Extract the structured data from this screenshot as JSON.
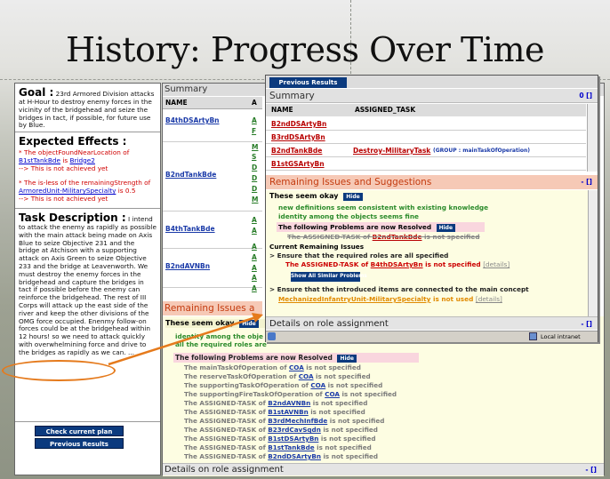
{
  "slide": {
    "title": "History: Progress Over Time"
  },
  "left_panel": {
    "goal_label": "Goal :",
    "goal_text": "23rd Armored Division attacks at H-Hour to destroy enemy forces in the vicinity of the bridgehead and seize the bridges in tact, if possible, for future use by Blue.",
    "effects_label": "Expected Effects :",
    "effect1_prefix": "* The objectFoundNearLocation of",
    "effect1_link1": "B1stTankBde",
    "effect1_is": "is",
    "effect1_link2": "Bridge2",
    "effect1_status": "--> This is not achieved yet",
    "effect2_prefix": "* The is-less of the remainingStrength of",
    "effect2_link": "ArmoredUnit-MilitarySpecialty",
    "effect2_suffix": "is 0.5",
    "effect2_status": "--> This is not achieved yet",
    "task_label": "Task Description :",
    "task_text": "I intend to attack the enemy as rapidly as possible with the main attack being made on Axis Blue to seize Objective 231 and the bridge at Atchison with a supporting attack on Axis Green to seize Objective 233 and the bridge at Leavenworth. We must destroy the enemy forces in the bridgehead and capture the bridges in tact if possible before the enemy can reinforce the bridgehead. The rest of III Corps will attack up the east side of the river and keep the other divisions of the OMG force occupied. Enenmy follow-on forces could be at the bridgehead within 12 hours! so we need to attack quickly with overwhelmining force and drive to the bridges as rapidly as we can. ...",
    "check_btn": "Check current plan",
    "prev_btn": "Previous Results"
  },
  "main_panel": {
    "summary": "Summary",
    "col_name": "NAME",
    "col_a": "A",
    "rows": [
      "B4thDSArtyBn",
      "B2ndTankBde",
      "B4thTankBde",
      "B2ndAVNBn"
    ],
    "a_col_letters": [
      "A",
      "F",
      "M",
      "S",
      "D",
      "D",
      "D",
      "M",
      "A",
      "A",
      "A",
      "A",
      "A",
      "A",
      "A"
    ],
    "remaining": "Remaining Issues a",
    "okay": "These seem okay",
    "okay_hide": "Hide",
    "okay_line1": "identity among the obje",
    "okay_line2": "all the required roles are",
    "resolved_label": "The following Problems are now Resolved",
    "resolved_hide": "Hide",
    "resolved_items": [
      {
        "pre": "The mainTaskOfOperation of ",
        "link": "COA",
        "post": " is not specified"
      },
      {
        "pre": "The reserveTaskOfOperation of ",
        "link": "COA",
        "post": " is not specified"
      },
      {
        "pre": "The supportingTaskOfOperation of ",
        "link": "COA",
        "post": " is not specified"
      },
      {
        "pre": "The supportingFireTaskOfOperation of ",
        "link": "COA",
        "post": " is not specified"
      },
      {
        "pre": "The ASSIGNED-TASK of ",
        "link": "B2ndAVNBn",
        "post": " is not specified"
      },
      {
        "pre": "The ASSIGNED-TASK of ",
        "link": "B1stAVNBn",
        "post": " is not specified"
      },
      {
        "pre": "The ASSIGNED-TASK of ",
        "link": "B3rdMechInfBde",
        "post": " is not specified"
      },
      {
        "pre": "The ASSIGNED-TASK of ",
        "link": "B23rdCavSqdn",
        "post": " is not specified"
      },
      {
        "pre": "The ASSIGNED-TASK of ",
        "link": "B1stDSArtyBn",
        "post": " is not specified"
      },
      {
        "pre": "The ASSIGNED-TASK of ",
        "link": "B1stTankBde",
        "post": " is not specified"
      },
      {
        "pre": "The ASSIGNED-TASK of ",
        "link": "B2ndDSArtyBn",
        "post": " is not specified"
      }
    ],
    "details": "Details on role assignment",
    "details_ctl": "- []"
  },
  "overlay": {
    "tab": "Previous Results",
    "summary": "Summary",
    "summary_ctl": "0 []",
    "col_name": "NAME",
    "col_task": "ASSIGNED_TASK",
    "rows": [
      {
        "name": "B2ndDSArtyBn",
        "task": "",
        "group": ""
      },
      {
        "name": "B3rdDSArtyBn",
        "task": "",
        "group": ""
      },
      {
        "name": "B2ndTankBde",
        "task": "Destroy-MilitaryTask",
        "group": "(GROUP : mainTaskOfOperation)"
      },
      {
        "name": "B1stGSArtyBn",
        "task": "",
        "group": ""
      }
    ],
    "remaining": "Remaining Issues and Suggestions",
    "remaining_ctl": "- []",
    "okay": "These seem okay",
    "okay_hide": "Hide",
    "okay_line1": "new definitions seem consistent with existing knowledge",
    "okay_line2": "identity among the objects seems fine",
    "now_resolved": "The following Problems are now Resolved",
    "now_resolved_hide": "Hide",
    "struck_pre": "The ASSIGNED-TASK of ",
    "struck_link": "B2ndTankBde",
    "struck_post": " is not specified",
    "current": "Current Remaining Issues",
    "issue1": "> Ensure that the required roles are all specified",
    "issue1_pre": "The ASSIGNED-TASK of ",
    "issue1_link": "B4thDSArtyBn",
    "issue1_post": " is not specified",
    "details_link": "[details]",
    "show_btn": "Show All Similar Problems",
    "issue2": "> Ensure that the introduced items are connected to the main concept",
    "issue2_link": "MechanizedInfantryUnit-MilitarySpecialty",
    "issue2_post": " is not used",
    "details": "Details on role assignment",
    "details_ctl": "- []",
    "status": "Local intranet"
  },
  "colors": {
    "accent_orange": "#e57a1c",
    "button_blue": "#0b3a7e",
    "issue_red": "#d00000"
  }
}
